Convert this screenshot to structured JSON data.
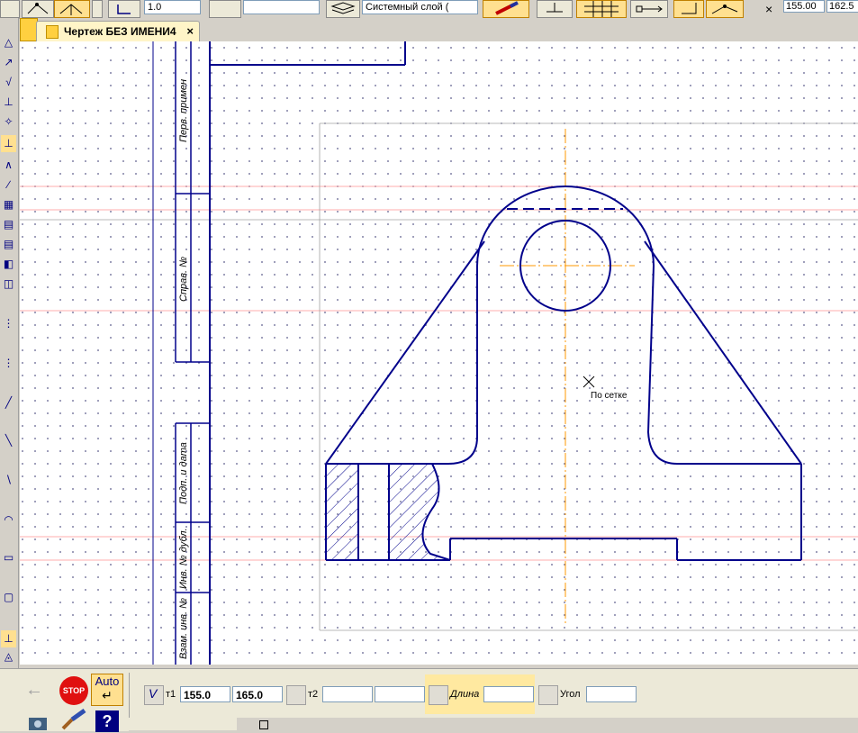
{
  "toolbar": {
    "step_value": "1.0",
    "layer_value": "Системный слой (",
    "coord_x": "155.00",
    "coord_y": "162.5"
  },
  "document_tab": {
    "title": "Чертеж БЕЗ ИМЕНИ4",
    "close_glyph": "×"
  },
  "canvas": {
    "snap_label": "По сетке",
    "title_block_labels": {
      "perv_primen": "Перв. примен",
      "sprav_no": "Справ. №",
      "podp_i_data": "Подп. и дата",
      "inv_no_dubl": "Инв. № дубл.",
      "vzam_inv_no": "Взам. инв. №"
    },
    "colors": {
      "outline": "#00008b",
      "axis": "#ff9900",
      "grid": "#5a5a8a",
      "guide": "#ff6060"
    }
  },
  "bottom_panel": {
    "stop_label": "STOP",
    "auto_label": "Auto",
    "help_label": "?",
    "t1_label": "т1",
    "t1_x": "155.0",
    "t1_y": "165.0",
    "t2_label": "т2",
    "t2_x": "",
    "t2_y": "",
    "length_label": "Длина",
    "length_value": "",
    "angle_label": "Угол",
    "angle_value": ""
  }
}
